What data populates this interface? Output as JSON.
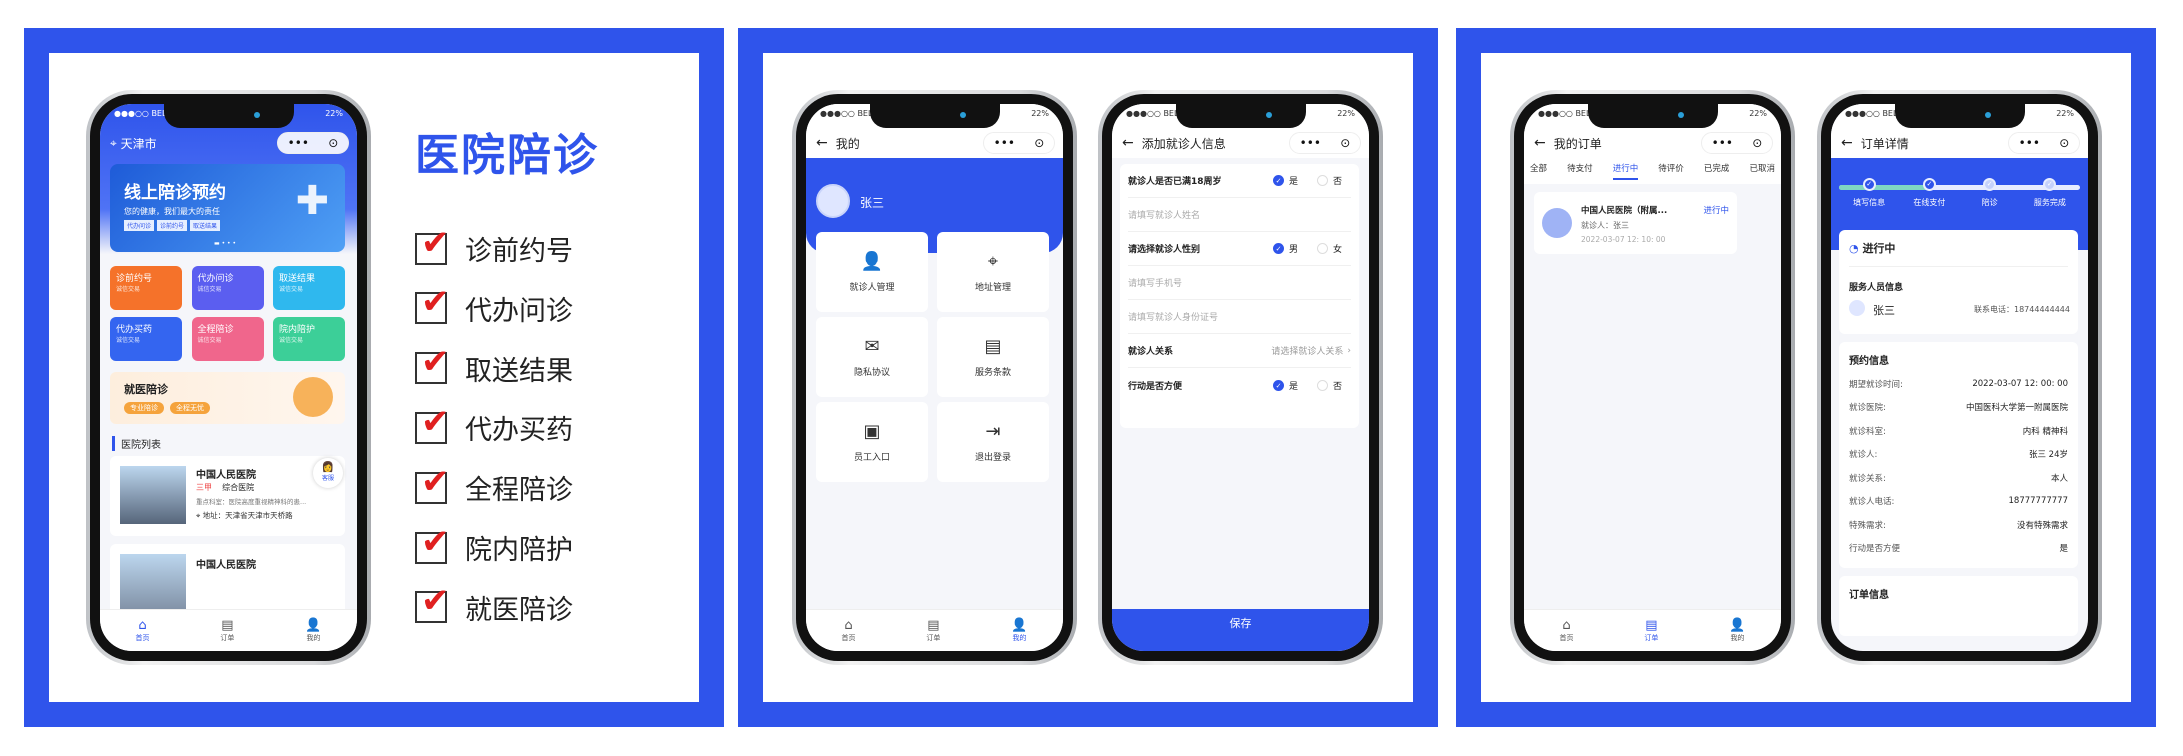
{
  "status": {
    "carrier": "●●●○○ BELL",
    "battery": "22%"
  },
  "capsule": {
    "more": "•••",
    "target": "⊙"
  },
  "tabbar": [
    {
      "label": "首页",
      "icon": "home-icon"
    },
    {
      "label": "订单",
      "icon": "order-icon"
    },
    {
      "label": "我的",
      "icon": "user-icon"
    }
  ],
  "promo": {
    "title": "医院陪诊",
    "features": [
      "诊前约号",
      "代办问诊",
      "取送结果",
      "代办买药",
      "全程陪诊",
      "院内陪护",
      "就医陪诊"
    ]
  },
  "home": {
    "city": "天津市",
    "banner": {
      "title": "线上陪诊预约",
      "subtitle": "您的健康，我们最大的责任",
      "tags": [
        "代办问诊",
        "诊前约号",
        "取送结果"
      ]
    },
    "tiles": [
      {
        "title": "诊前约号",
        "sub": "诚信交易",
        "color": "#f5722a"
      },
      {
        "title": "代办问诊",
        "sub": "诚信交易",
        "color": "#5b5ef0"
      },
      {
        "title": "取送结果",
        "sub": "诚信交易",
        "color": "#2fb8ee"
      },
      {
        "title": "代办买药",
        "sub": "诚信交易",
        "color": "#3465f0"
      },
      {
        "title": "全程陪诊",
        "sub": "诚信交易",
        "color": "#f0668c"
      },
      {
        "title": "院内陪护",
        "sub": "诚信交易",
        "color": "#3ccf98"
      }
    ],
    "promo_card": {
      "title": "就医陪诊",
      "tags": [
        "专业陪诊",
        "全程无忧"
      ]
    },
    "list_title": "医院列表",
    "hospitals": [
      {
        "name": "中国人民医院",
        "grade": "三甲",
        "type": "综合医院",
        "desc": "重点科室：医院高度重视精神科的患...",
        "address": "地址：天津省天津市天桥路"
      },
      {
        "name": "中国人民医院"
      }
    ],
    "service_label": "客服"
  },
  "mine": {
    "title": "我的",
    "name": "张三",
    "menu": [
      {
        "label": "就诊人管理",
        "icon": "patient-manage-icon",
        "glyph": "👤"
      },
      {
        "label": "地址管理",
        "icon": "location-icon",
        "glyph": "⌖"
      },
      {
        "label": "隐私协议",
        "icon": "envelope-icon",
        "glyph": "✉"
      },
      {
        "label": "服务条款",
        "icon": "document-icon",
        "glyph": "▤"
      },
      {
        "label": "员工入口",
        "icon": "badge-icon",
        "glyph": "▣"
      },
      {
        "label": "退出登录",
        "icon": "logout-icon",
        "glyph": "⇥"
      }
    ]
  },
  "add_patient": {
    "title": "添加就诊人信息",
    "adult_label": "就诊人是否已满18周岁",
    "yes": "是",
    "no": "否",
    "name_ph": "请填写就诊人姓名",
    "gender_label": "请选择就诊人性别",
    "male": "男",
    "female": "女",
    "phone_ph": "请填写手机号",
    "id_ph": "请填写就诊人身份证号",
    "relation_label": "就诊人关系",
    "relation_ph": "请选择就诊人关系",
    "mobility_label": "行动是否方便",
    "save": "保存"
  },
  "orders": {
    "title": "我的订单",
    "tabs": [
      "全部",
      "待支付",
      "进行中",
      "待评价",
      "已完成",
      "已取消"
    ],
    "active_tab": 2,
    "item": {
      "hospital": "中国人民医院（附属...",
      "status": "进行中",
      "patient": "就诊人：张三",
      "time": "2022-03-07  12: 10: 00"
    }
  },
  "detail": {
    "title": "订单详情",
    "steps": [
      "填写信息",
      "在线支付",
      "陪诊",
      "服务完成"
    ],
    "completed_steps": 2,
    "status": "进行中",
    "staff_title": "服务人员信息",
    "staff_name": "张三",
    "staff_phone": "联系电话：18744444444",
    "info_title": "预约信息",
    "rows": [
      [
        "期望就诊时间:",
        "2022-03-07  12: 00: 00"
      ],
      [
        "就诊医院:",
        "中国医科大学第一附属医院"
      ],
      [
        "就诊科室:",
        "内科  精神科"
      ],
      [
        "就诊人:",
        "张三  24岁"
      ],
      [
        "就诊关系:",
        "本人"
      ],
      [
        "就诊人电话:",
        "18777777777"
      ],
      [
        "特殊需求:",
        "没有特殊需求"
      ],
      [
        "行动是否方便",
        "是"
      ]
    ],
    "next_title": "订单信息"
  },
  "colors": {
    "brand": "#2f54eb",
    "check": "#e02020"
  }
}
